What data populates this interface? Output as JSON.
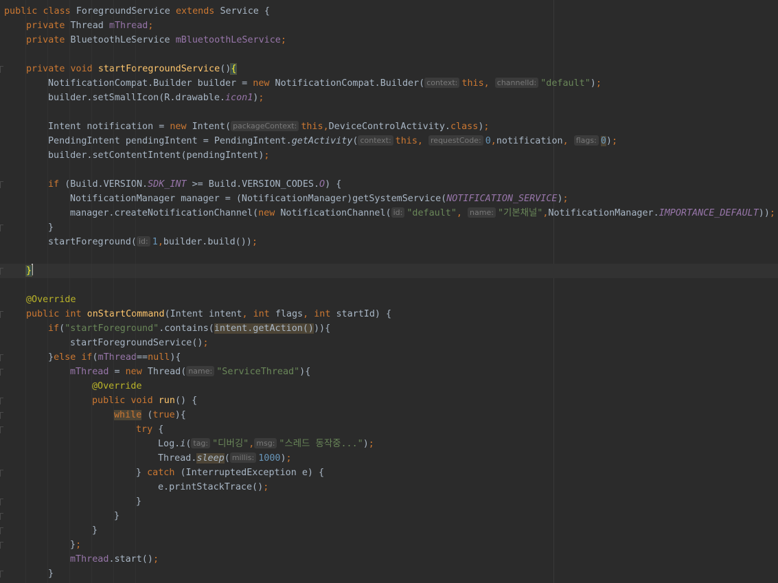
{
  "editor": {
    "language": "Java",
    "lines": [
      [
        [
          "k",
          "public "
        ],
        [
          "k",
          "class "
        ],
        [
          "t",
          "ForegroundService "
        ],
        [
          "k",
          "extends "
        ],
        [
          "t",
          "Service {"
        ]
      ],
      [
        [
          "k",
          "private "
        ],
        [
          "t",
          "Thread "
        ],
        [
          "fld",
          "mThread"
        ],
        [
          "k",
          ";"
        ]
      ],
      [
        [
          "k",
          "private "
        ],
        [
          "t",
          "BluetoothLeService "
        ],
        [
          "fld",
          "mBluetoothLeService"
        ],
        [
          "k",
          ";"
        ]
      ],
      [],
      [
        [
          "k",
          "private "
        ],
        [
          "k",
          "void "
        ],
        [
          "f",
          "startForegroundService"
        ],
        [
          "t",
          "()"
        ],
        [
          "brace",
          "{"
        ]
      ],
      [
        [
          "t",
          "NotificationCompat.Builder builder = "
        ],
        [
          "k",
          "new "
        ],
        [
          "t",
          "NotificationCompat.Builder("
        ],
        [
          "hint",
          "context:"
        ],
        [
          "k",
          "this"
        ],
        [
          "k",
          ", "
        ],
        [
          "hint",
          "channelId:"
        ],
        [
          "s",
          "\"default\""
        ],
        [
          "t",
          ")"
        ],
        [
          "k",
          ";"
        ]
      ],
      [
        [
          "t",
          "builder.setSmallIcon(R.drawable."
        ],
        [
          "fld-it",
          "icon1"
        ],
        [
          "t",
          ")"
        ],
        [
          "k",
          ";"
        ]
      ],
      [],
      [
        [
          "t",
          "Intent notification = "
        ],
        [
          "k",
          "new "
        ],
        [
          "t",
          "Intent("
        ],
        [
          "hint",
          "packageContext:"
        ],
        [
          "k",
          "this"
        ],
        [
          "k",
          ","
        ],
        [
          "t",
          "DeviceControlActivity."
        ],
        [
          "k",
          "class"
        ],
        [
          "t",
          ")"
        ],
        [
          "k",
          ";"
        ]
      ],
      [
        [
          "t",
          "PendingIntent pendingIntent = PendingIntent."
        ],
        [
          "it",
          "getActivity"
        ],
        [
          "t",
          "("
        ],
        [
          "hint",
          "context:"
        ],
        [
          "k",
          "this"
        ],
        [
          "k",
          ", "
        ],
        [
          "hint",
          "requestCode:"
        ],
        [
          "n",
          "0"
        ],
        [
          "k",
          ","
        ],
        [
          "t",
          "notification"
        ],
        [
          "k",
          ", "
        ],
        [
          "hint",
          "flags:"
        ],
        [
          "hln",
          "0"
        ],
        [
          "t",
          ")"
        ],
        [
          "k",
          ";"
        ]
      ],
      [
        [
          "t",
          "builder.setContentIntent(pendingIntent)"
        ],
        [
          "k",
          ";"
        ]
      ],
      [],
      [
        [
          "k",
          "if "
        ],
        [
          "t",
          "(Build.VERSION."
        ],
        [
          "st",
          "SDK_INT"
        ],
        [
          "t",
          " >= Build.VERSION_CODES."
        ],
        [
          "st",
          "O"
        ],
        [
          "t",
          ") {"
        ]
      ],
      [
        [
          "t",
          "NotificationManager manager = (NotificationManager)getSystemService("
        ],
        [
          "st",
          "NOTIFICATION_SERVICE"
        ],
        [
          "t",
          ")"
        ],
        [
          "k",
          ";"
        ]
      ],
      [
        [
          "t",
          "manager.createNotificationChannel("
        ],
        [
          "k",
          "new "
        ],
        [
          "t",
          "NotificationChannel("
        ],
        [
          "hint",
          "id:"
        ],
        [
          "s",
          "\"default\""
        ],
        [
          "k",
          ", "
        ],
        [
          "hint",
          "name:"
        ],
        [
          "s",
          "\"기본채널\""
        ],
        [
          "k",
          ","
        ],
        [
          "t",
          "NotificationManager."
        ],
        [
          "st",
          "IMPORTANCE_DEFAULT"
        ],
        [
          "t",
          "))"
        ],
        [
          "k",
          ";"
        ]
      ],
      [
        [
          "t",
          "}"
        ]
      ],
      [
        [
          "t",
          "startForeground("
        ],
        [
          "hint",
          "id:"
        ],
        [
          "n",
          "1"
        ],
        [
          "k",
          ","
        ],
        [
          "t",
          "builder.build())"
        ],
        [
          "k",
          ";"
        ]
      ],
      [],
      [
        [
          "brace",
          "}"
        ]
      ],
      [],
      [
        [
          "a",
          "@Override"
        ]
      ],
      [
        [
          "k",
          "public "
        ],
        [
          "k",
          "int "
        ],
        [
          "f",
          "onStartCommand"
        ],
        [
          "t",
          "(Intent intent"
        ],
        [
          "k",
          ", "
        ],
        [
          "k",
          "int "
        ],
        [
          "t",
          "flags"
        ],
        [
          "k",
          ", "
        ],
        [
          "k",
          "int "
        ],
        [
          "t",
          "startId) {"
        ]
      ],
      [
        [
          "k",
          "if"
        ],
        [
          "t",
          "("
        ],
        [
          "s",
          "\"startForeground\""
        ],
        [
          "t",
          ".contains("
        ],
        [
          "hlw",
          "intent.getAction()"
        ],
        [
          "t",
          "))"
        ],
        [
          "t",
          "{"
        ]
      ],
      [
        [
          "t",
          "startForegroundService()"
        ],
        [
          "k",
          ";"
        ]
      ],
      [
        [
          "t",
          "}"
        ],
        [
          "k",
          "else if"
        ],
        [
          "t",
          "("
        ],
        [
          "fld",
          "mThread"
        ],
        [
          "t",
          "=="
        ],
        [
          "k",
          "null"
        ],
        [
          "t",
          "){"
        ]
      ],
      [
        [
          "fld",
          "mThread "
        ],
        [
          "t",
          "= "
        ],
        [
          "k",
          "new "
        ],
        [
          "t",
          "Thread("
        ],
        [
          "hint",
          "name:"
        ],
        [
          "s",
          "\"ServiceThread\""
        ],
        [
          "t",
          "){"
        ]
      ],
      [
        [
          "a",
          "@Override"
        ]
      ],
      [
        [
          "k",
          "public "
        ],
        [
          "k",
          "void "
        ],
        [
          "f",
          "run"
        ],
        [
          "t",
          "() {"
        ]
      ],
      [
        [
          "hlwk",
          "while"
        ],
        [
          "t",
          " ("
        ],
        [
          "k",
          "true"
        ],
        [
          "t",
          "){"
        ]
      ],
      [
        [
          "k",
          "try "
        ],
        [
          "t",
          "{"
        ]
      ],
      [
        [
          "t",
          "Log."
        ],
        [
          "it",
          "i"
        ],
        [
          "t",
          "("
        ],
        [
          "hint",
          "tag:"
        ],
        [
          "s",
          "\"디버깅\""
        ],
        [
          "k",
          ","
        ],
        [
          "hint",
          "msg:"
        ],
        [
          "s",
          "\"스레드 동작중...\""
        ],
        [
          "t",
          ")"
        ],
        [
          "k",
          ";"
        ]
      ],
      [
        [
          "t",
          "Thread."
        ],
        [
          "hlwi",
          "sleep"
        ],
        [
          "t",
          "("
        ],
        [
          "hint",
          "millis:"
        ],
        [
          "n",
          "1000"
        ],
        [
          "t",
          ")"
        ],
        [
          "k",
          ";"
        ]
      ],
      [
        [
          "t",
          "} "
        ],
        [
          "k",
          "catch "
        ],
        [
          "t",
          "(InterruptedException e) {"
        ]
      ],
      [
        [
          "t",
          "e.printStackTrace()"
        ],
        [
          "k",
          ";"
        ]
      ],
      [
        [
          "t",
          "}"
        ]
      ],
      [
        [
          "t",
          "}"
        ]
      ],
      [
        [
          "t",
          "}"
        ]
      ],
      [
        [
          "t",
          "}"
        ],
        [
          "k",
          ";"
        ]
      ],
      [
        [
          "fld",
          "mThread"
        ],
        [
          "t",
          ".start()"
        ],
        [
          "k",
          ";"
        ]
      ],
      [
        [
          "t",
          "}"
        ]
      ]
    ]
  }
}
